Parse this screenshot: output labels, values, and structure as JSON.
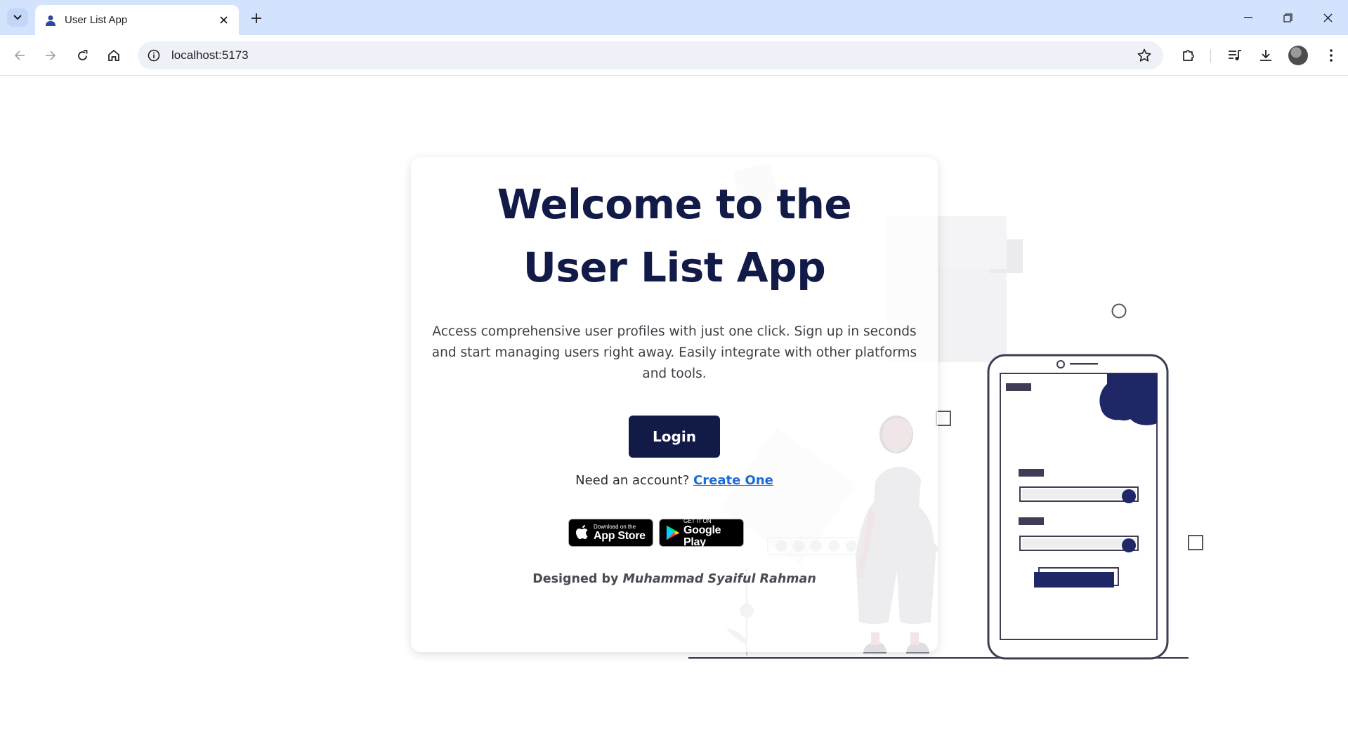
{
  "browser": {
    "tab_title": "User List App",
    "url": "localhost:5173"
  },
  "icons": {
    "tab_search": "chevron-down-icon",
    "favicon": "user-icon",
    "close_tab": "close-icon",
    "new_tab": "plus-icon",
    "back": "arrow-left-icon",
    "forward": "arrow-right-icon",
    "reload": "reload-icon",
    "home": "home-icon",
    "site_info": "info-icon",
    "bookmark": "star-icon",
    "extensions": "puzzle-icon",
    "media": "playlist-icon",
    "downloads": "download-icon",
    "menu": "kebab-menu-icon"
  },
  "hero": {
    "title_line1": "Welcome to the",
    "title_line2": "User List App",
    "description": "Access comprehensive user profiles with just one click. Sign up in seconds and start managing users right away. Easily integrate with other platforms and tools.",
    "login_label": "Login",
    "signup_prompt": "Need an account?",
    "signup_link": "Create One",
    "credit_prefix": "Designed by",
    "credit_name": "Muhammad Syaiful Rahman"
  },
  "stores": {
    "apple_small": "Download on the",
    "apple_big": "App Store",
    "google_small": "GET IT ON",
    "google_big": "Google Play"
  },
  "colors": {
    "primary": "#121a48",
    "link": "#1a6bd8",
    "tabbar": "#d3e3fd"
  }
}
